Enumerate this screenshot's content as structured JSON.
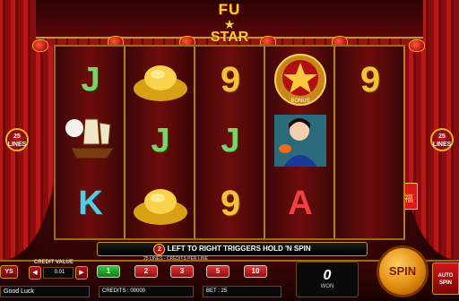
{
  "game": {
    "logo_top": "FU",
    "logo_bottom": "STAR"
  },
  "side_panels": {
    "lines_badge": "25 LINES",
    "lantern_glyph": "福"
  },
  "reels": [
    [
      "J",
      "boat",
      "K"
    ],
    [
      "gold-ingot",
      "J",
      "gold-ingot"
    ],
    [
      "9",
      "J",
      "9"
    ],
    [
      "star-bonus",
      "girl",
      "A"
    ],
    [
      "9",
      "",
      ""
    ]
  ],
  "symbols": {
    "star_bonus_label": "BONUS"
  },
  "trigger_banner": {
    "number": "2",
    "text": "LEFT TO RIGHT TRIGGERS HOLD 'N SPIN"
  },
  "controls": {
    "lines_info": "25 LINES - CREDITS PER LINE",
    "line_buttons": [
      "1",
      "2",
      "3",
      "5",
      "10"
    ],
    "active_line_index": 0,
    "credit_value_label": "CREDIT VALUE",
    "credit_value": "0.01",
    "message": "Good Luck",
    "credits_label": "CREDITS : 00000",
    "bet_label": "BET : 25",
    "win_value": "0",
    "win_label": "WON",
    "spin_label": "SPIN",
    "autospin_label": "AUTO SPIN",
    "pays_label": "YS"
  },
  "colors": {
    "gold": "#f2c23a",
    "red": "#b81818",
    "green": "#34c83a"
  }
}
